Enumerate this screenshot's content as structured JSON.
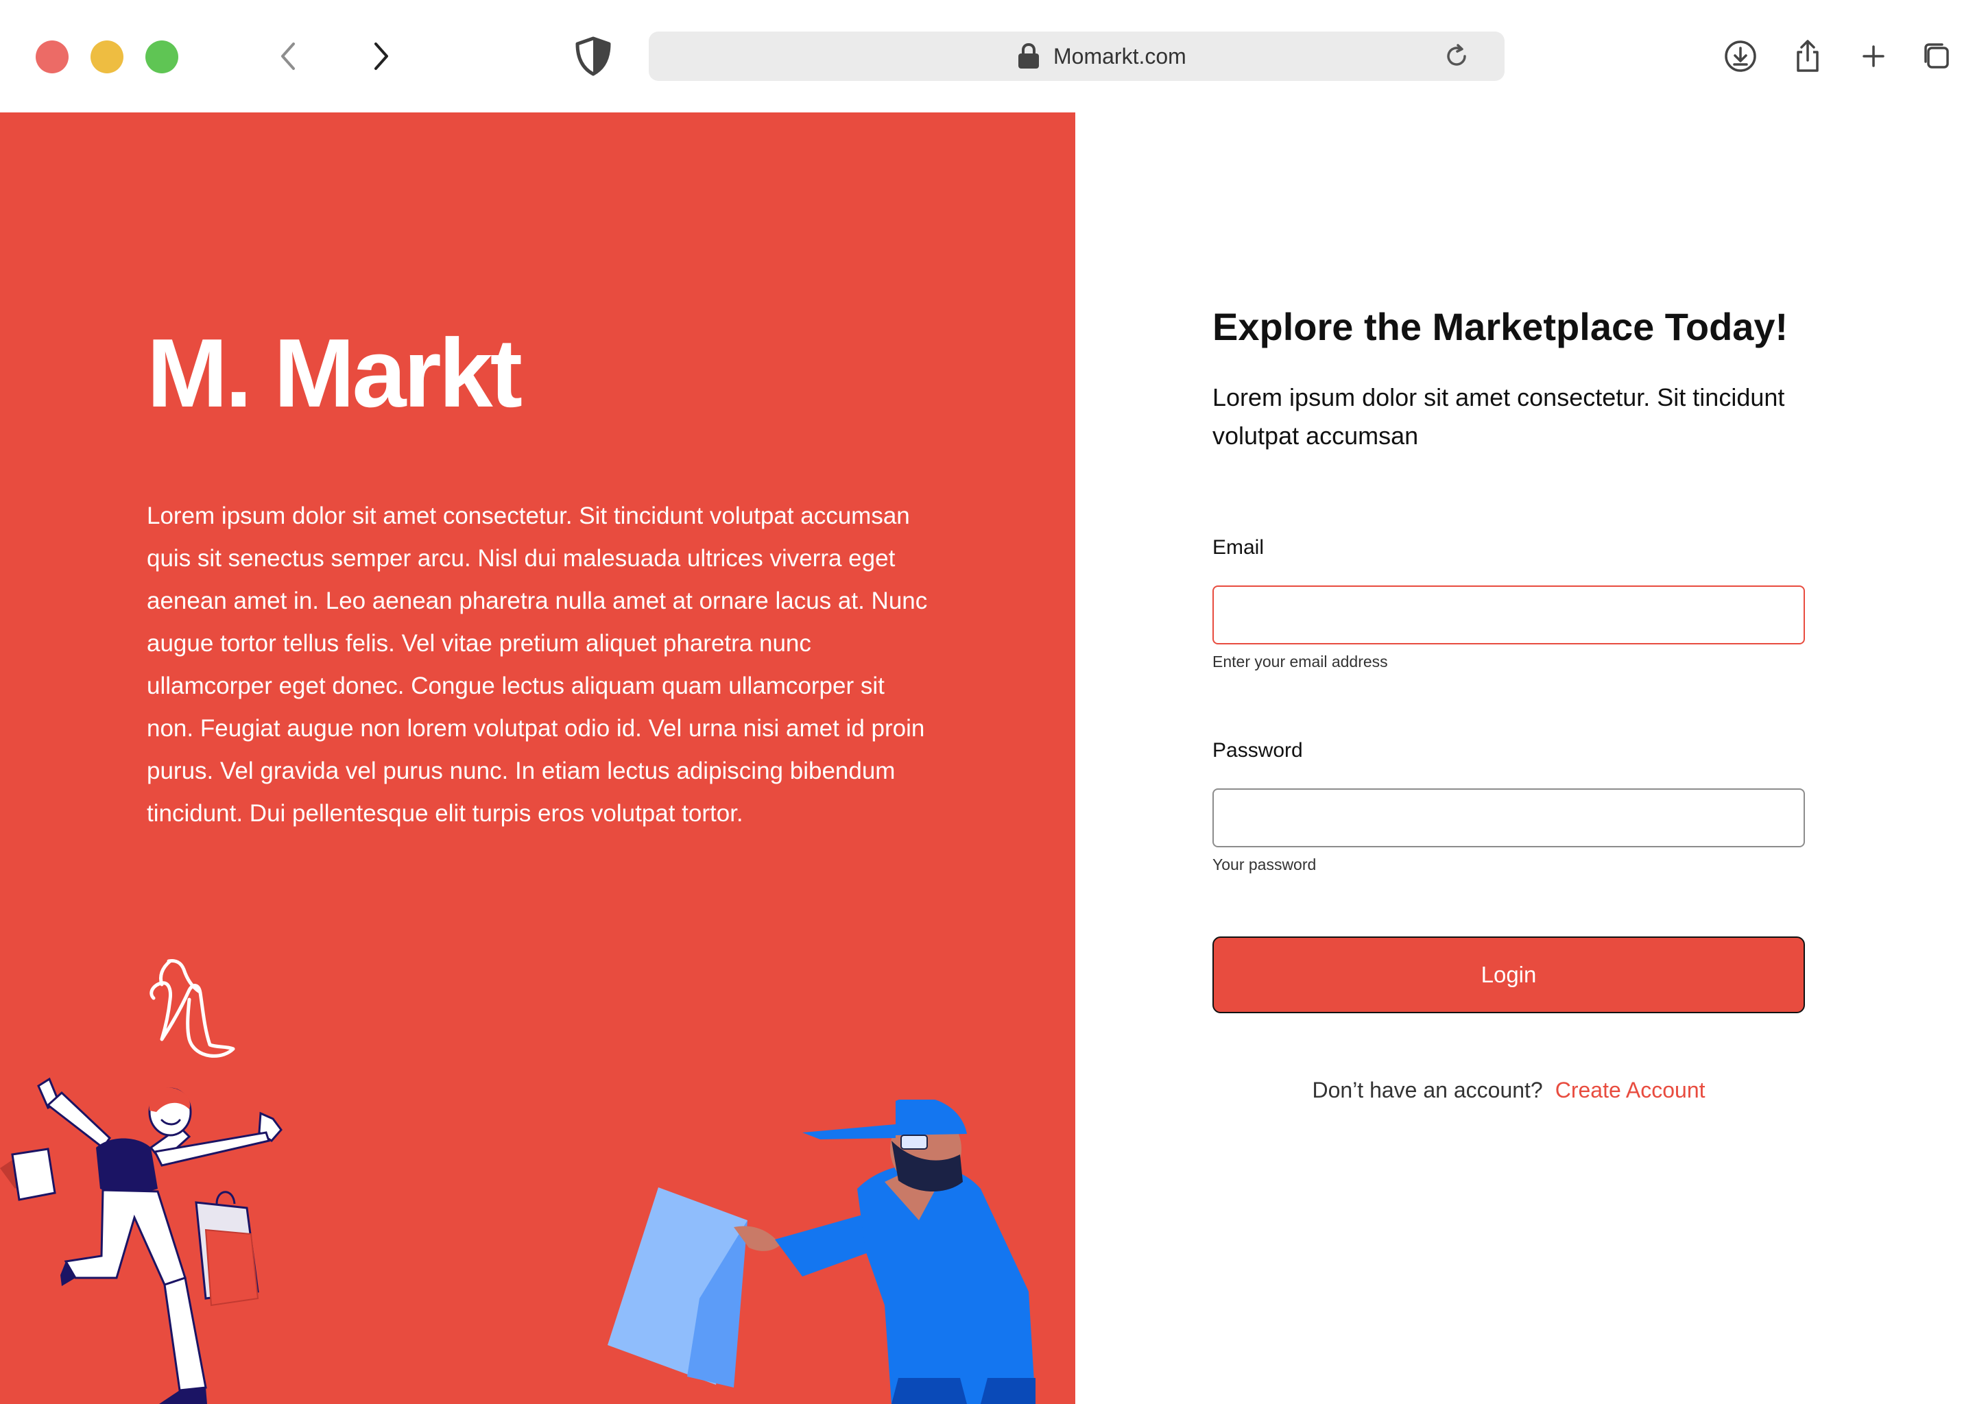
{
  "browser": {
    "url": "Momarkt.com"
  },
  "brand": {
    "logo": "M. Markt",
    "description": "Lorem ipsum dolor sit amet consectetur. Sit tincidunt volutpat accumsan quis sit senectus semper arcu. Nisl dui malesuada ultrices viverra eget aenean amet in. Leo aenean pharetra nulla amet at ornare lacus at. Nunc augue tortor tellus felis. Vel vitae pretium aliquet pharetra nunc ullamcorper eget donec. Congue lectus aliquam quam ullamcorper sit non. Feugiat augue non lorem volutpat odio id. Vel urna nisi amet id proin purus. Vel gravida vel purus nunc. In etiam lectus adipiscing bibendum tincidunt. Dui pellentesque elit turpis eros volutpat tortor.",
    "accent_color": "#e84c3f"
  },
  "login": {
    "title": "Explore the Marketplace Today!",
    "subtitle": "Lorem ipsum dolor sit amet consectetur. Sit tincidunt volutpat accumsan",
    "email_label": "Email",
    "email_value": "",
    "email_hint": "Enter your email address",
    "password_label": "Password",
    "password_value": "",
    "password_hint": "Your password",
    "button_label": "Login",
    "signup_prompt": "Don’t have an account?",
    "signup_link": "Create Account"
  },
  "icons": {
    "toolbar": [
      "back-icon",
      "forward-icon",
      "shield-icon",
      "lock-icon",
      "reload-icon",
      "download-icon",
      "share-icon",
      "new-tab-icon",
      "tabs-overview-icon"
    ]
  }
}
